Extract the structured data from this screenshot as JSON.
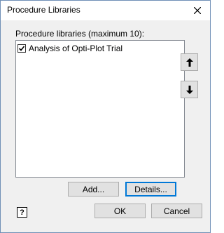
{
  "window": {
    "title": "Procedure Libraries",
    "close_icon": "close-icon"
  },
  "list": {
    "label": "Procedure libraries (maximum 10):",
    "items": [
      {
        "label": "Analysis of Opti-Plot Trial",
        "checked": true
      }
    ]
  },
  "side_buttons": {
    "move_up_icon": "arrow-up-icon",
    "move_down_icon": "arrow-down-icon"
  },
  "buttons": {
    "add": "Add...",
    "details": "Details...",
    "help": "?",
    "ok": "OK",
    "cancel": "Cancel"
  }
}
